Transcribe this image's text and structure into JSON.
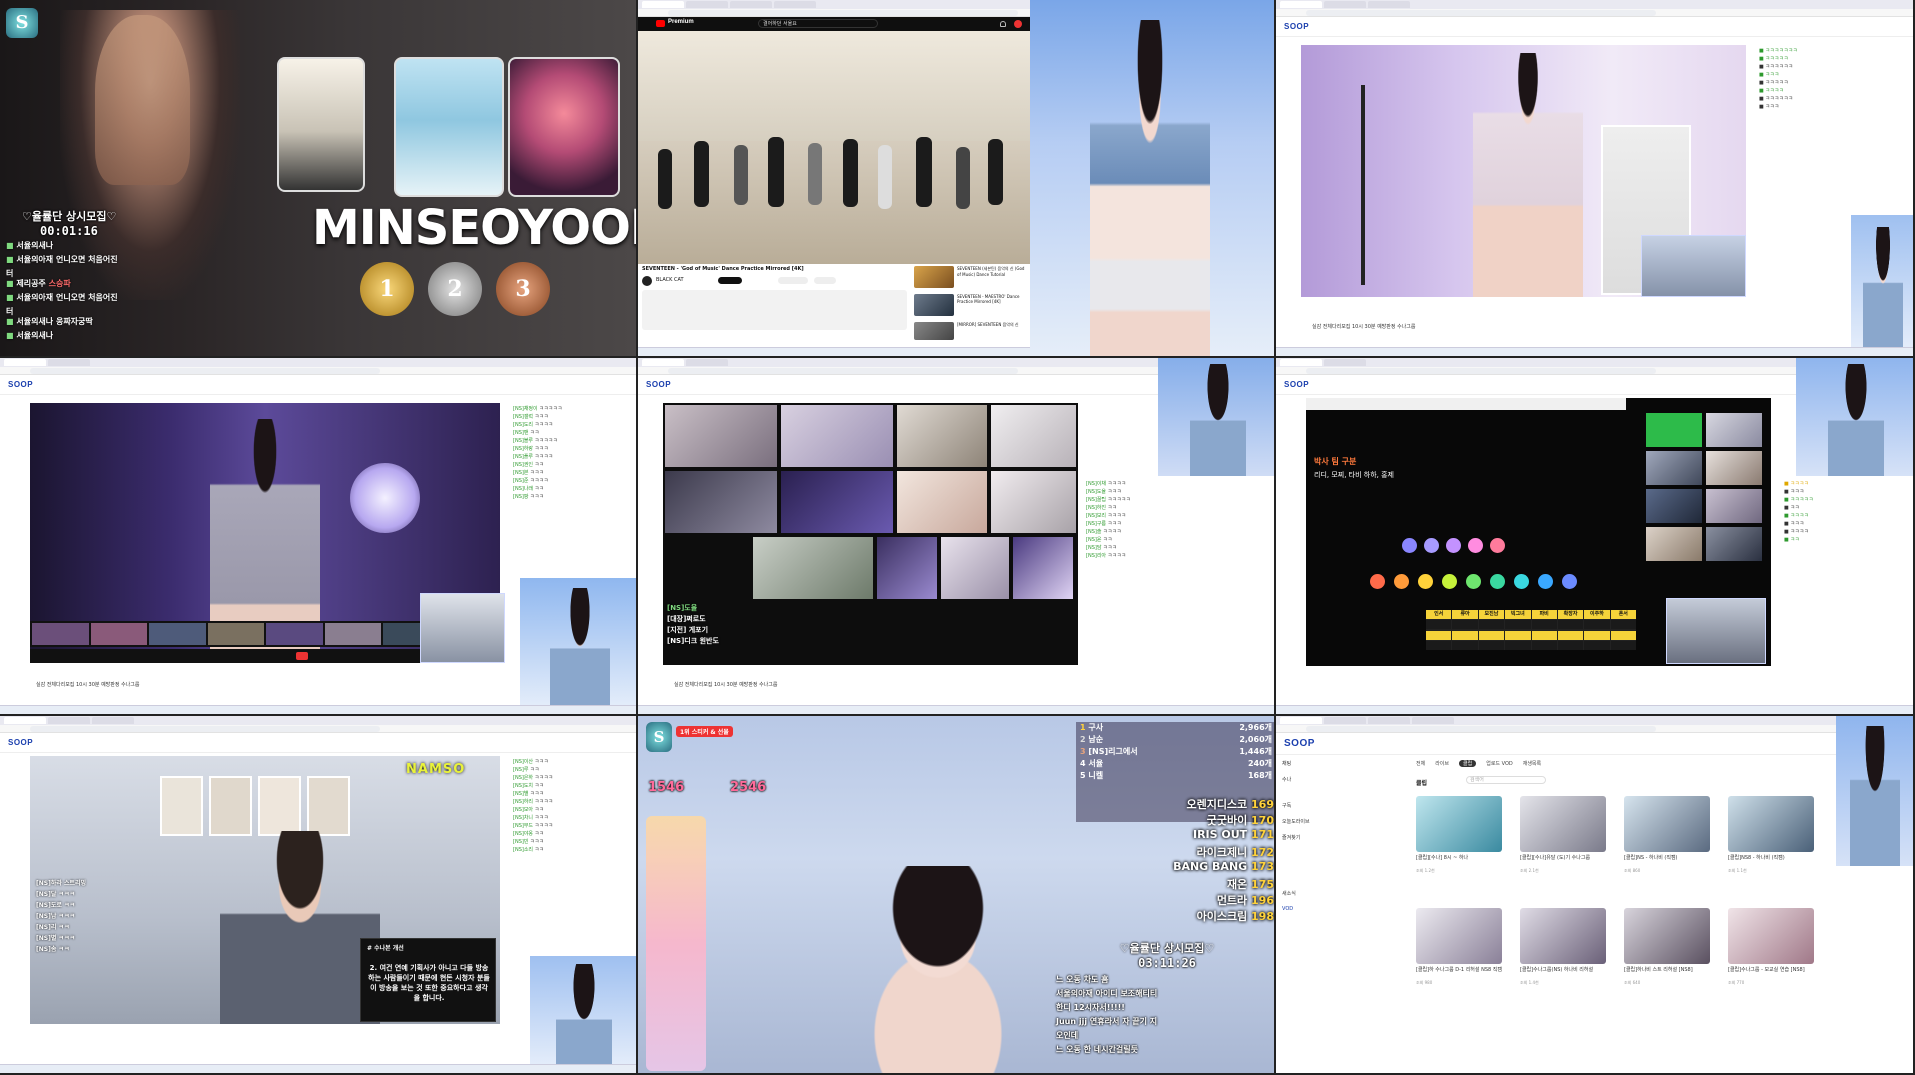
{
  "cell1": {
    "banner_title": "MINSEOYOOL",
    "recruit_label": "♡율률단 상시모집♡",
    "timer": "00:01:16",
    "ranks": [
      "1",
      "2",
      "3"
    ],
    "chat": [
      {
        "user": "서율의새나",
        "msg": ""
      },
      {
        "user": "서율의아재",
        "msg": "언니오면 처음어진"
      },
      {
        "user": "",
        "msg": "터"
      },
      {
        "user": "제리공주",
        "msg": "스승파"
      },
      {
        "user": "서율의아재",
        "msg": "언니오면 처음어진"
      },
      {
        "user": "",
        "msg": "터"
      },
      {
        "user": "서율의새나",
        "msg": "웅짜자궁딱"
      },
      {
        "user": "서율의새나",
        "msg": ""
      }
    ]
  },
  "cell2": {
    "site_label": "Premium",
    "search_text": "결어하던 서울요",
    "video_title": "SEVENTEEN - 'God of Music' Dance Practice Mirrored [4K]",
    "channel": "BLACK CAT",
    "side_video_1": "SEVENTEEN (세븐틴) 음악의 신 (God of Music) Dance Tutorial",
    "side_video_2": "SEVENTEEN - MAESTRO' Dance Practice Mirrored [4K]",
    "side_video_3": "[MIRROR] SEVENTEEN 음악의 신"
  },
  "cell3": {
    "logo": "SOOP",
    "stream_title": "실감 전체다리모집 10시 30분 예방판정 수나그룹"
  },
  "cell4": {
    "logo": "SOOP",
    "stream_title": "실감 전체다리모집 10시 30분 예방판정 수나그룹",
    "chat": [
      "[NS]채정이",
      "[NS]갤럭",
      "[NS]도리",
      "[NS]맨",
      "[NS]블루",
      "[NS]하랑",
      "[NS]플루",
      "[NS]권인",
      "[NS]본",
      "[NS]준",
      "[NS]나래",
      "[NS]팡"
    ]
  },
  "cell5": {
    "logo": "SOOP",
    "stream_title": "실감 전체다리모집 10시 30분 예방판정 수나그룹",
    "overlay_lines": [
      "[NS]도율",
      "[대장]쩌로도",
      "[지전] 게포기",
      "[NS]디크 원반도"
    ],
    "chat": [
      "[NS]이채",
      "[NS]도율",
      "[NS]꿀팁",
      "[NS]하진",
      "[NS]보리",
      "[NS]구름",
      "[NS]솔",
      "[NS]윤",
      "[NS]담",
      "[NS]리아"
    ]
  },
  "cell6": {
    "logo": "SOOP",
    "overlay_title": "박사 팀 구분",
    "overlay_sub": "리디, 모찌, 타비 하하, 홍제",
    "dot_colors_top": [
      "#8a86ff",
      "#a79bff",
      "#c392ff",
      "#ff8ce0",
      "#ff7b9c"
    ],
    "dot_colors_bottom": [
      "#ff6b4a",
      "#ff9b3a",
      "#ffd23a",
      "#c6f23a",
      "#6ee66e",
      "#3ad8a0",
      "#3ad8e0",
      "#3aa8ff",
      "#6b8bff"
    ],
    "table_labels": [
      "인서",
      "류아",
      "모진남",
      "빅그녀",
      "파비",
      "확장자",
      "이주하",
      "혼서"
    ]
  },
  "cell7": {
    "logo": "SOOP",
    "overlay_brand": "NAMSO",
    "caption_tag": "# 수나본 개선",
    "caption": "2. 여건 연예 기획사가 아니고 다들 방송하는 사람들이기 때문에 현돈 시청자 분들이 방송을 보는 것 또한 중요하다고 생각을 합니다.",
    "chat": [
      "[NS]이산",
      "[NS]루",
      "[NS]은하",
      "[NS]도치",
      "[NS]별",
      "[NS]하리",
      "[NS]모아",
      "[NS]차니",
      "[NS]무드",
      "[NS]야옹",
      "[NS]빈",
      "[NS]소리"
    ]
  },
  "cell8": {
    "gift_top": "1위 스티커 & 선물",
    "scores_left": [
      "1546",
      "2546"
    ],
    "recruit_label": "♡율률단 상시모집♡",
    "timer": "03:11:26",
    "leaderboard": [
      {
        "rank": "1",
        "name": "구사",
        "score": "2,966개"
      },
      {
        "rank": "2",
        "name": "남순",
        "score": "2,060개"
      },
      {
        "rank": "3",
        "name": "[NS]리그에서",
        "score": "1,446개"
      },
      {
        "rank": "4",
        "name": "서율",
        "score": "240개"
      },
      {
        "rank": "5",
        "name": "니켈",
        "score": "168개"
      }
    ],
    "ranking": [
      {
        "name": "오렌지디스코",
        "value": "169"
      },
      {
        "name": "굿굿바이",
        "value": "170"
      },
      {
        "name": "IRIS OUT",
        "value": "171"
      },
      {
        "name": "라이크제니",
        "value": "172"
      },
      {
        "name": "BANG BANG",
        "value": "173"
      },
      {
        "name": "재온",
        "value": "175"
      },
      {
        "name": "먼트라",
        "value": "196"
      },
      {
        "name": "아이스크림",
        "value": "198"
      }
    ],
    "chat": [
      "느  오동 차도 흠",
      "서울의아재 아이디 보조해티티",
      "한디 12시자서!!!!!",
      "Juun jjj 연휴라서 자 끝기 지",
      "오인데",
      "느  오동 한 네시간걸릴듯"
    ]
  },
  "cell9": {
    "logo": "SOOP",
    "sidebar": [
      "채팅",
      "수나",
      "구독",
      "오늘도라이브",
      "즐겨찾기",
      "새소식",
      "VOD"
    ],
    "tabs": [
      "전체",
      "라이브",
      "클립",
      "업로드 VOD",
      "재생목록"
    ],
    "section_label": "클립",
    "search_placeholder": "검색어",
    "videos": [
      {
        "title": "[클립][수나] 8시 ~ 하나",
        "meta": "조회 1.2천"
      },
      {
        "title": "[클립][수나]유달 (도)기 수나그룹",
        "meta": "조회 2.1천"
      },
      {
        "title": "[클립]NS - 하나비 (직캠)",
        "meta": "조회 860"
      },
      {
        "title": "[클립]NS8 - 하나비 (직캠)",
        "meta": "조회 1.1천"
      },
      {
        "title": "[클립]하 수나그룹 D-1 리허설 NS8 직캠",
        "meta": "조회 980"
      },
      {
        "title": "[클립]수나그룹(NS) 하나비 리허설",
        "meta": "조회 1.4천"
      },
      {
        "title": "[클립]하나비 스트 리허설 [NS8]",
        "meta": "조회 640"
      },
      {
        "title": "[클립]수나그룹 - 모교실 연습 [NS8]",
        "meta": "조회 770"
      }
    ]
  }
}
